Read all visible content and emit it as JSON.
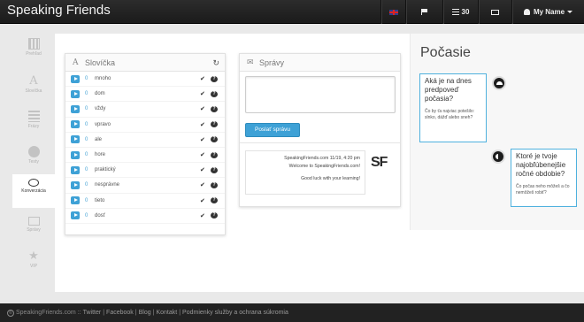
{
  "app": {
    "brand": "Speaking Friends"
  },
  "navbar": {
    "messages_count": "30",
    "user_label": "My Name"
  },
  "sidebar": {
    "items": [
      {
        "label": "Prehľad",
        "icon": "bar-chart-icon"
      },
      {
        "label": "Slovíčka",
        "icon": "font-icon"
      },
      {
        "label": "Frázy",
        "icon": "list-icon"
      },
      {
        "label": "Testy",
        "icon": "dashboard-icon"
      },
      {
        "label": "Konverzácia",
        "icon": "chat-bubble-icon"
      },
      {
        "label": "Správy",
        "icon": "envelope-icon"
      },
      {
        "label": "VIP",
        "icon": "star-icon"
      }
    ]
  },
  "words_panel": {
    "title": "Slovíčka",
    "rows": [
      {
        "count": "0",
        "word": "mnoho"
      },
      {
        "count": "0",
        "word": "dom"
      },
      {
        "count": "0",
        "word": "vždy"
      },
      {
        "count": "0",
        "word": "vpravo"
      },
      {
        "count": "0",
        "word": "ale"
      },
      {
        "count": "0",
        "word": "hore"
      },
      {
        "count": "0",
        "word": "praktický"
      },
      {
        "count": "0",
        "word": "nesprávne"
      },
      {
        "count": "0",
        "word": "tieto"
      },
      {
        "count": "0",
        "word": "dosť"
      }
    ]
  },
  "messages_panel": {
    "title": "Správy",
    "send_label": "Poslať správu",
    "message_meta": "SpeakingFriends.com 11/19, 4:20 pm",
    "message_line1": "Welcome to SpeakingFriends.com!",
    "message_line2": "Good luck with your learning!",
    "logo": "SF"
  },
  "weather": {
    "title": "Počasie",
    "bubble1_big": "Aká je na dnes predpoveď počasia?",
    "bubble1_small": "Čo by ťa najviac potešilo: slnko, dážď alebo sneh?",
    "bubble2_big": "Ktoré je tvoje najobľúbenejšie ročné obdobie?",
    "bubble2_small": "Čo počas neho môžeš a čo nemôžeš robiť?"
  },
  "footer": {
    "site": "SpeakingFriends.com",
    "sep0": "::",
    "links": [
      "Twitter",
      "Facebook",
      "Blog",
      "Kontakt",
      "Podmienky služby a ochrana súkromia"
    ]
  },
  "colors": {
    "accent": "#3ea1d6",
    "navbar": "#222222"
  }
}
